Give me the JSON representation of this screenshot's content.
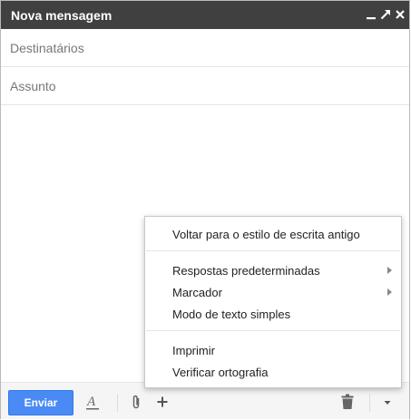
{
  "window": {
    "title": "Nova mensagem"
  },
  "fields": {
    "to_placeholder": "Destinatários",
    "subject_placeholder": "Assunto"
  },
  "toolbar": {
    "send_label": "Enviar"
  },
  "menu": {
    "group1": [
      "Voltar para o estilo de escrita antigo"
    ],
    "group2": [
      {
        "label": "Respostas predeterminadas",
        "submenu": true
      },
      {
        "label": "Marcador",
        "submenu": true
      },
      {
        "label": "Modo de texto simples",
        "submenu": false
      }
    ],
    "group3": [
      "Imprimir",
      "Verificar ortografia"
    ]
  },
  "icons": {
    "minimize": "minimize-icon",
    "expand": "expand-icon",
    "close": "close-icon",
    "formatting": "text-formatting-icon",
    "attach": "paperclip-icon",
    "insert": "plus-icon",
    "discard": "trash-icon",
    "more": "chevron-down-icon"
  },
  "colors": {
    "titlebar": "#404040",
    "send_button": "#4a8af4"
  }
}
